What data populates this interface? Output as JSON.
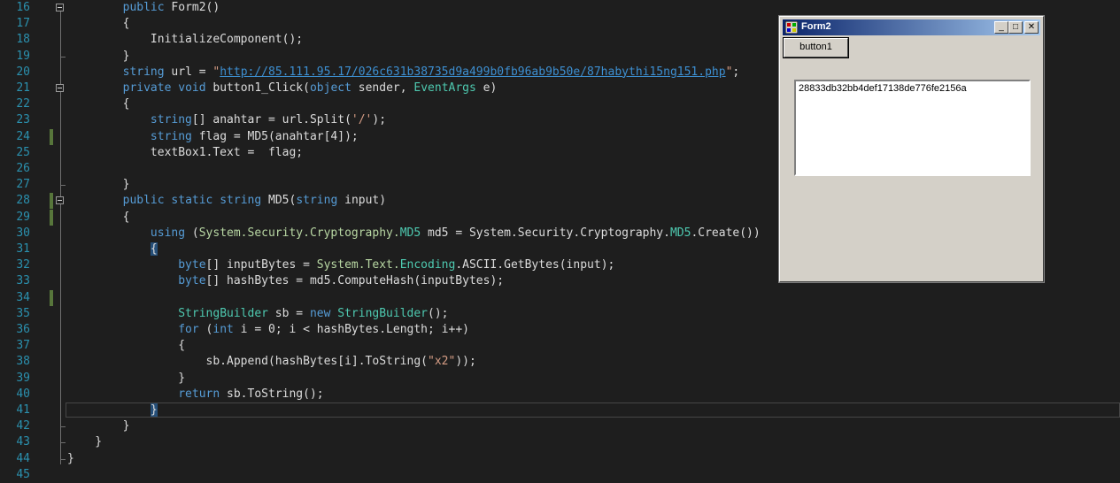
{
  "editor": {
    "lines": [
      {
        "n": "16",
        "tokens": [
          [
            "        ",
            ""
          ],
          [
            "public",
            "kw"
          ],
          [
            " Form2()",
            ""
          ]
        ]
      },
      {
        "n": "17",
        "tokens": [
          [
            "        {",
            ""
          ]
        ]
      },
      {
        "n": "18",
        "tokens": [
          [
            "            InitializeComponent();",
            ""
          ]
        ]
      },
      {
        "n": "19",
        "tokens": [
          [
            "        }",
            ""
          ]
        ]
      },
      {
        "n": "20",
        "tokens": [
          [
            "        ",
            ""
          ],
          [
            "string",
            "kw"
          ],
          [
            " url = ",
            ""
          ],
          [
            "\"",
            "st"
          ],
          [
            "http://85.111.95.17/026c631b38735d9a499b0fb96ab9b50e/87habythi15ng151.php",
            "url"
          ],
          [
            "\"",
            "st"
          ],
          [
            ";",
            ""
          ]
        ]
      },
      {
        "n": "21",
        "tokens": [
          [
            "        ",
            ""
          ],
          [
            "private",
            "kw"
          ],
          [
            " ",
            ""
          ],
          [
            "void",
            "kw"
          ],
          [
            " button1_Click(",
            ""
          ],
          [
            "object",
            "kw"
          ],
          [
            " sender, ",
            ""
          ],
          [
            "EventArgs",
            "ty"
          ],
          [
            " e)",
            ""
          ]
        ]
      },
      {
        "n": "22",
        "tokens": [
          [
            "        {",
            ""
          ]
        ]
      },
      {
        "n": "23",
        "tokens": [
          [
            "            ",
            ""
          ],
          [
            "string",
            "kw"
          ],
          [
            "[] anahtar = url.Split(",
            ""
          ],
          [
            "'/'",
            "st"
          ],
          [
            ");",
            ""
          ]
        ]
      },
      {
        "n": "24",
        "tokens": [
          [
            "            ",
            ""
          ],
          [
            "string",
            "kw"
          ],
          [
            " flag = MD5(anahtar[4]);",
            ""
          ]
        ]
      },
      {
        "n": "25",
        "tokens": [
          [
            "            textBox1.Text =  flag;",
            ""
          ]
        ]
      },
      {
        "n": "26",
        "tokens": []
      },
      {
        "n": "27",
        "tokens": [
          [
            "        }",
            ""
          ]
        ]
      },
      {
        "n": "28",
        "tokens": [
          [
            "        ",
            ""
          ],
          [
            "public",
            "kw"
          ],
          [
            " ",
            ""
          ],
          [
            "static",
            "kw"
          ],
          [
            " ",
            ""
          ],
          [
            "string",
            "kw"
          ],
          [
            " MD5(",
            ""
          ],
          [
            "string",
            "kw"
          ],
          [
            " input)",
            ""
          ]
        ]
      },
      {
        "n": "29",
        "tokens": [
          [
            "        {",
            ""
          ]
        ]
      },
      {
        "n": "30",
        "tokens": [
          [
            "            ",
            ""
          ],
          [
            "using",
            "kw"
          ],
          [
            " (",
            ""
          ],
          [
            "System.Security.Cryptography.",
            "ns"
          ],
          [
            "MD5",
            "ty"
          ],
          [
            " md5 = System.Security.Cryptography.",
            ""
          ],
          [
            "MD5",
            "ty"
          ],
          [
            ".Create())",
            ""
          ]
        ]
      },
      {
        "n": "31",
        "tokens": [
          [
            "            ",
            ""
          ],
          [
            "{",
            "brace"
          ]
        ]
      },
      {
        "n": "32",
        "tokens": [
          [
            "                ",
            ""
          ],
          [
            "byte",
            "kw"
          ],
          [
            "[] inputBytes = ",
            ""
          ],
          [
            "System.Text.",
            "ns"
          ],
          [
            "Encoding",
            "ty"
          ],
          [
            ".ASCII.GetBytes(input);",
            ""
          ]
        ]
      },
      {
        "n": "33",
        "tokens": [
          [
            "                ",
            ""
          ],
          [
            "byte",
            "kw"
          ],
          [
            "[] hashBytes = md5.ComputeHash(inputBytes);",
            ""
          ]
        ]
      },
      {
        "n": "34",
        "tokens": []
      },
      {
        "n": "35",
        "tokens": [
          [
            "                ",
            ""
          ],
          [
            "StringBuilder",
            "ty"
          ],
          [
            " sb = ",
            ""
          ],
          [
            "new",
            "kw"
          ],
          [
            " ",
            ""
          ],
          [
            "StringBuilder",
            "ty"
          ],
          [
            "();",
            ""
          ]
        ]
      },
      {
        "n": "36",
        "tokens": [
          [
            "                ",
            ""
          ],
          [
            "for",
            "kw"
          ],
          [
            " (",
            ""
          ],
          [
            "int",
            "kw"
          ],
          [
            " i = 0; i < hashBytes.Length; i++)",
            ""
          ]
        ]
      },
      {
        "n": "37",
        "tokens": [
          [
            "                {",
            ""
          ]
        ]
      },
      {
        "n": "38",
        "tokens": [
          [
            "                    sb.Append(hashBytes[i].ToString(",
            ""
          ],
          [
            "\"x2\"",
            "st"
          ],
          [
            "));",
            ""
          ]
        ]
      },
      {
        "n": "39",
        "tokens": [
          [
            "                }",
            ""
          ]
        ]
      },
      {
        "n": "40",
        "tokens": [
          [
            "                ",
            ""
          ],
          [
            "return",
            "kw"
          ],
          [
            " sb.ToString();",
            ""
          ]
        ]
      },
      {
        "n": "41",
        "tokens": [
          [
            "            ",
            ""
          ],
          [
            "}",
            "brace"
          ]
        ]
      },
      {
        "n": "42",
        "tokens": [
          [
            "        }",
            ""
          ]
        ]
      },
      {
        "n": "43",
        "tokens": [
          [
            "    }",
            ""
          ]
        ]
      },
      {
        "n": "44",
        "tokens": [
          [
            "}",
            ""
          ]
        ]
      },
      {
        "n": "45",
        "tokens": []
      }
    ],
    "changed_lines": [
      "24",
      "28",
      "29",
      "34"
    ],
    "fold_lines": [
      "16",
      "21",
      "28"
    ],
    "current_line": "41"
  },
  "form2": {
    "title": "Form2",
    "minimize": "_",
    "maximize": "□",
    "close": "✕",
    "button_label": "button1",
    "textbox_value": "28833db32bb4def17138de776fe2156a"
  },
  "colors": {
    "editor_bg": "#1e1e1e",
    "keyword": "#569cd6",
    "type": "#4ec9b0",
    "string": "#d69d85",
    "line_number": "#2b91af",
    "change_marker": "#57763b"
  }
}
